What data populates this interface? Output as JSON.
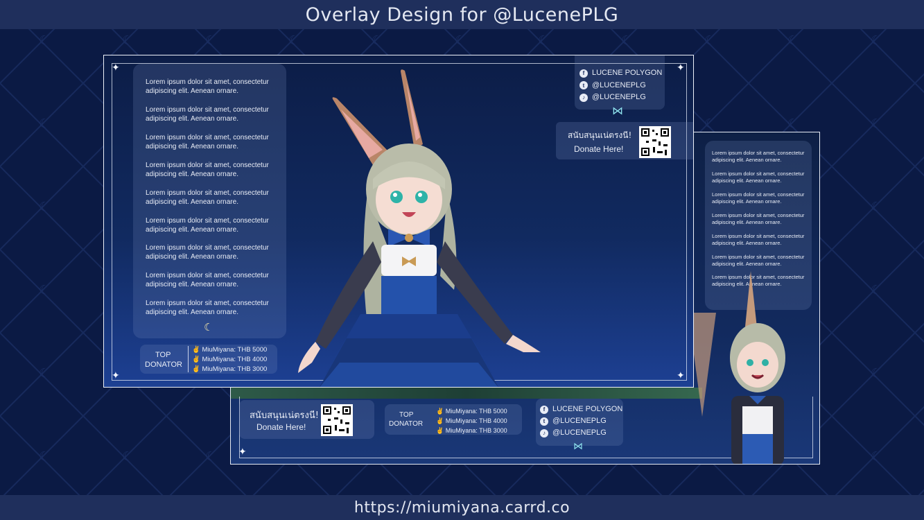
{
  "header": {
    "title": "Overlay Design for @LucenePLG"
  },
  "footer": {
    "url": "https://miumiyana.carrd.co"
  },
  "lorem_line1": "Lorem ipsum dolor sit amet, consectetur",
  "lorem_line2": "adipiscing elit. Aenean ornare.",
  "social": {
    "facebook": "LUCENE POLYGON",
    "twitter": "@LUCENEPLG",
    "tiktok": "@LUCENEPLG"
  },
  "donate": {
    "thai": "สนับสนุนเน่ตรงนี!",
    "label": "Donate Here!"
  },
  "top_donator": {
    "label_line1": "TOP",
    "label_line2": "DONATOR",
    "entries": [
      {
        "name": "MiuMiyana:",
        "amount": "THB 5000"
      },
      {
        "name": "MiuMiyana:",
        "amount": "THB 4000"
      },
      {
        "name": "MiuMiyana:",
        "amount": "THB 3000"
      }
    ]
  },
  "colors": {
    "background": "#0c1a45",
    "bar": "#1f2f5c",
    "accent_bow": "#8fe3ee"
  },
  "icons": [
    "facebook-icon",
    "twitter-icon",
    "tiktok-icon",
    "bow-icon",
    "moon-icon",
    "sparkle-icon",
    "bunny-icon",
    "qr-code"
  ]
}
